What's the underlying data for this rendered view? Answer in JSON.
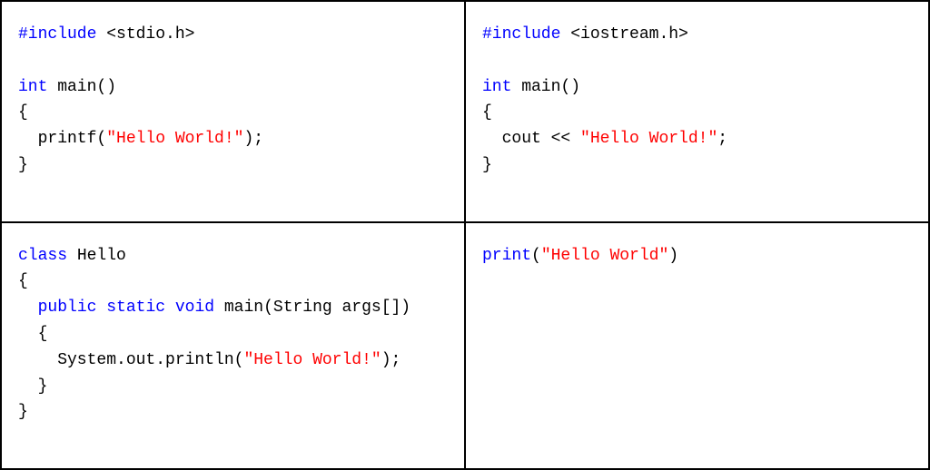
{
  "colors": {
    "keyword": "#0000ff",
    "string": "#ff0000",
    "plain": "#000000"
  },
  "cells": {
    "c": {
      "tokens": [
        [
          {
            "t": "kw",
            "v": "#include"
          },
          {
            "t": "plain",
            "v": " <stdio.h>"
          }
        ],
        [],
        [
          {
            "t": "kw",
            "v": "int"
          },
          {
            "t": "plain",
            "v": " main()"
          }
        ],
        [
          {
            "t": "plain",
            "v": "{"
          }
        ],
        [
          {
            "t": "plain",
            "v": "  printf("
          },
          {
            "t": "str",
            "v": "\"Hello World!\""
          },
          {
            "t": "plain",
            "v": ");"
          }
        ],
        [
          {
            "t": "plain",
            "v": "}"
          }
        ]
      ]
    },
    "cpp": {
      "tokens": [
        [
          {
            "t": "kw",
            "v": "#include"
          },
          {
            "t": "plain",
            "v": " <iostream.h>"
          }
        ],
        [],
        [
          {
            "t": "kw",
            "v": "int"
          },
          {
            "t": "plain",
            "v": " main()"
          }
        ],
        [
          {
            "t": "plain",
            "v": "{"
          }
        ],
        [
          {
            "t": "plain",
            "v": "  cout << "
          },
          {
            "t": "str",
            "v": "\"Hello World!\""
          },
          {
            "t": "plain",
            "v": ";"
          }
        ],
        [
          {
            "t": "plain",
            "v": "}"
          }
        ]
      ]
    },
    "java": {
      "tokens": [
        [
          {
            "t": "kw",
            "v": "class"
          },
          {
            "t": "plain",
            "v": " Hello"
          }
        ],
        [
          {
            "t": "plain",
            "v": "{"
          }
        ],
        [
          {
            "t": "plain",
            "v": "  "
          },
          {
            "t": "kw",
            "v": "public"
          },
          {
            "t": "plain",
            "v": " "
          },
          {
            "t": "kw",
            "v": "static"
          },
          {
            "t": "plain",
            "v": " "
          },
          {
            "t": "kw",
            "v": "void"
          },
          {
            "t": "plain",
            "v": " main(String args[])"
          }
        ],
        [
          {
            "t": "plain",
            "v": "  {"
          }
        ],
        [
          {
            "t": "plain",
            "v": "    System.out.println("
          },
          {
            "t": "str",
            "v": "\"Hello World!\""
          },
          {
            "t": "plain",
            "v": ");"
          }
        ],
        [
          {
            "t": "plain",
            "v": "  }"
          }
        ],
        [
          {
            "t": "plain",
            "v": "}"
          }
        ]
      ]
    },
    "python": {
      "tokens": [
        [
          {
            "t": "kw",
            "v": "print"
          },
          {
            "t": "plain",
            "v": "("
          },
          {
            "t": "str",
            "v": "\"Hello World\""
          },
          {
            "t": "plain",
            "v": ")"
          }
        ]
      ]
    }
  }
}
